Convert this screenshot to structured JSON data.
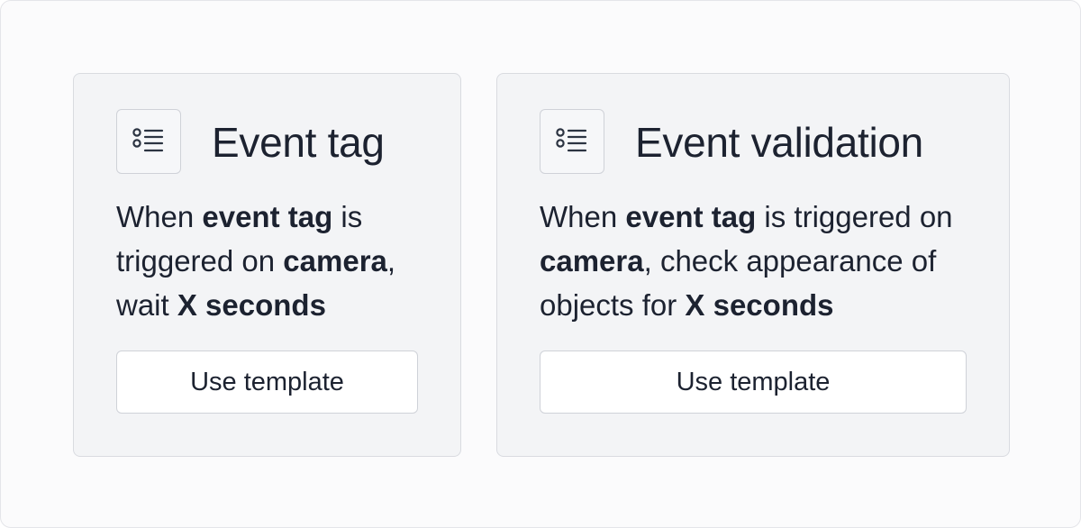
{
  "cards": [
    {
      "icon": "list-icon",
      "title": "Event tag",
      "description": [
        {
          "text": "When ",
          "bold": false
        },
        {
          "text": "event tag",
          "bold": true
        },
        {
          "text": " is triggered on ",
          "bold": false
        },
        {
          "text": "camera",
          "bold": true
        },
        {
          "text": ", wait ",
          "bold": false
        },
        {
          "text": "X seconds",
          "bold": true
        }
      ],
      "button_label": "Use template"
    },
    {
      "icon": "list-icon",
      "title": "Event validation",
      "description": [
        {
          "text": "When ",
          "bold": false
        },
        {
          "text": "event tag",
          "bold": true
        },
        {
          "text": " is triggered on ",
          "bold": false
        },
        {
          "text": "camera",
          "bold": true
        },
        {
          "text": ", check appearance of objects for ",
          "bold": false
        },
        {
          "text": "X seconds",
          "bold": true
        }
      ],
      "button_label": "Use template"
    }
  ],
  "colors": {
    "text": "#1c2230",
    "card_bg": "#f3f4f6",
    "border": "#d9dbe0",
    "button_bg": "#ffffff"
  }
}
